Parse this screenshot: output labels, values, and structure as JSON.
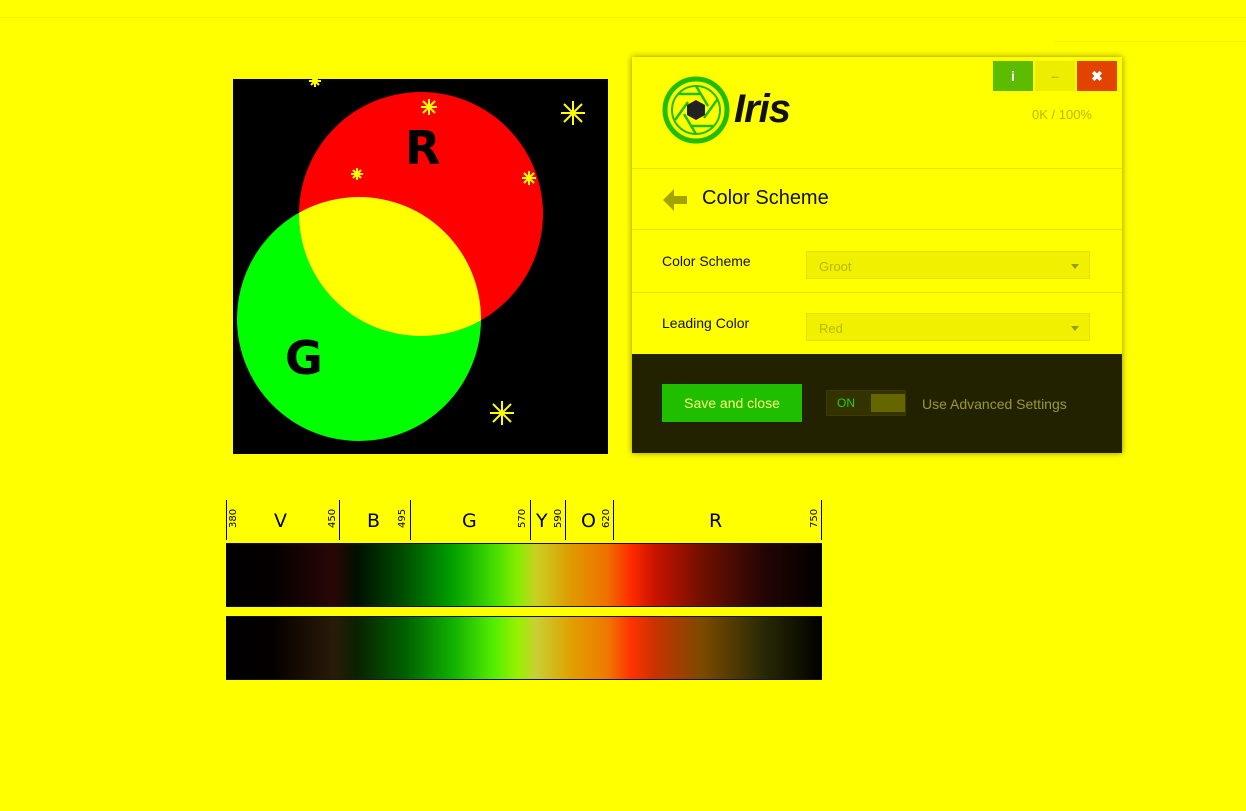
{
  "figure": {
    "label_r": "R",
    "label_g": "G",
    "colors": {
      "red": "#ff0000",
      "green": "#00ff00",
      "overlap": "#ffff00",
      "background": "#000000"
    }
  },
  "spectrum": {
    "ticks": [
      "380",
      "450",
      "495",
      "570",
      "590",
      "620",
      "750"
    ],
    "bands": [
      "V",
      "B",
      "G",
      "Y",
      "O",
      "R"
    ]
  },
  "panel": {
    "logo_text": "Iris",
    "usage": "0K / 100%",
    "window_buttons": {
      "info": "i",
      "minimize": "–",
      "close": "✖"
    },
    "section_title": "Color Scheme",
    "rows": [
      {
        "label": "Color Scheme",
        "value": "Groot"
      },
      {
        "label": "Leading Color",
        "value": "Red"
      }
    ],
    "save_button": "Save and close",
    "toggle_state": "ON",
    "advanced_label": "Use Advanced Settings"
  },
  "colors": {
    "background": "#ffff00",
    "accent_green": "#1fbf00",
    "close_red": "#e24400",
    "footer_dark": "#222200"
  }
}
